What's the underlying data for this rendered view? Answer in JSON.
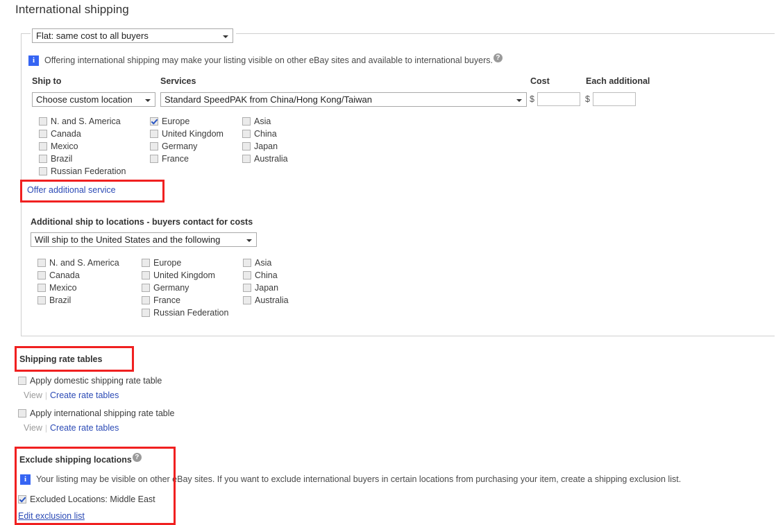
{
  "page": {
    "title": "International shipping"
  },
  "international": {
    "shipping_type_value": "Flat: same cost to all buyers",
    "info_text": "Offering international shipping may make your listing visible on other eBay sites and available to international buyers.",
    "help_icon": "question-mark-icon",
    "info_icon": "info-icon",
    "headers": {
      "ship_to": "Ship to",
      "services": "Services",
      "cost": "Cost",
      "each_additional": "Each additional"
    },
    "ship_to_value": "Choose custom location",
    "service_value": "Standard SpeedPAK from China/Hong Kong/Taiwan",
    "currency_symbol": "$",
    "cost_value": "",
    "cost_placeholder": "",
    "each_additional_value": "",
    "each_additional_placeholder": "",
    "locations": {
      "col1": [
        {
          "label": "N. and S. America",
          "checked": false
        },
        {
          "label": "Canada",
          "checked": false
        },
        {
          "label": "Mexico",
          "checked": false
        },
        {
          "label": "Brazil",
          "checked": false
        },
        {
          "label": "Russian Federation",
          "checked": false
        }
      ],
      "col2": [
        {
          "label": "Europe",
          "checked": true
        },
        {
          "label": "United Kingdom",
          "checked": false
        },
        {
          "label": "Germany",
          "checked": false
        },
        {
          "label": "France",
          "checked": false
        }
      ],
      "col3": [
        {
          "label": "Asia",
          "checked": false
        },
        {
          "label": "China",
          "checked": false
        },
        {
          "label": "Japan",
          "checked": false
        },
        {
          "label": "Australia",
          "checked": false
        }
      ]
    },
    "offer_additional_service_label": "Offer additional service"
  },
  "additional_locations": {
    "heading": "Additional ship to locations - buyers contact for costs",
    "select_value": "Will ship to the United States and the following",
    "locations": {
      "col1": [
        {
          "label": "N. and S. America",
          "checked": false
        },
        {
          "label": "Canada",
          "checked": false
        },
        {
          "label": "Mexico",
          "checked": false
        },
        {
          "label": "Brazil",
          "checked": false
        }
      ],
      "col2": [
        {
          "label": "Europe",
          "checked": false
        },
        {
          "label": "United Kingdom",
          "checked": false
        },
        {
          "label": "Germany",
          "checked": false
        },
        {
          "label": "France",
          "checked": false
        },
        {
          "label": "Russian Federation",
          "checked": false
        }
      ],
      "col3": [
        {
          "label": "Asia",
          "checked": false
        },
        {
          "label": "China",
          "checked": false
        },
        {
          "label": "Japan",
          "checked": false
        },
        {
          "label": "Australia",
          "checked": false
        }
      ]
    }
  },
  "rate_tables": {
    "heading": "Shipping rate tables",
    "domestic": {
      "label": "Apply domestic shipping rate table",
      "checked": false,
      "view_label": "View",
      "create_label": "Create rate tables"
    },
    "international": {
      "label": "Apply international shipping rate table",
      "checked": false,
      "view_label": "View",
      "create_label": "Create rate tables"
    }
  },
  "exclude": {
    "heading": "Exclude shipping locations",
    "help_icon": "question-mark-icon",
    "info_icon": "info-icon",
    "info_text": "Your listing may be visible on other eBay sites. If you want to exclude international buyers in certain locations from purchasing your item, create a shipping exclusion list.",
    "excluded_label": "Excluded Locations: Middle East",
    "excluded_checked": true,
    "edit_link_label": "Edit exclusion list"
  },
  "colors": {
    "link": "#2b4ab5",
    "info_badge": "#3665f3",
    "annotation_box": "#f02020",
    "border": "#cfcfcf",
    "muted_text": "#9a9a9a"
  }
}
